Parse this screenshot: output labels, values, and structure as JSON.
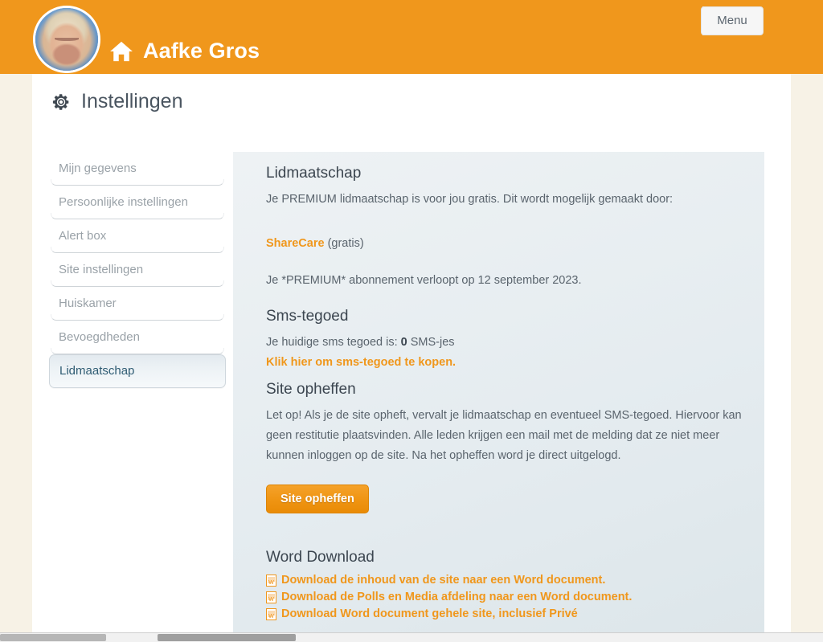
{
  "header": {
    "site_name": "Aafke Gros",
    "home_icon": "home-icon",
    "avatar_alt": "avatar",
    "mini_avatar_alt": "account-avatar",
    "menu_label": "Menu",
    "bar_color": "#f0971c"
  },
  "page": {
    "title": "Instellingen",
    "gear_icon": "gear-icon"
  },
  "sidebar": {
    "items": [
      {
        "label": "Mijn gegevens",
        "active": false
      },
      {
        "label": "Persoonlijke instellingen",
        "active": false
      },
      {
        "label": "Alert box",
        "active": false
      },
      {
        "label": "Site instellingen",
        "active": false
      },
      {
        "label": "Huiskamer",
        "active": false
      },
      {
        "label": "Bevoegdheden",
        "active": false
      },
      {
        "label": "Lidmaatschap",
        "active": true
      }
    ]
  },
  "main": {
    "membership": {
      "heading": "Lidmaatschap",
      "intro": "Je PREMIUM lidmaatschap is voor jou gratis. Dit wordt mogelijk gemaakt door:",
      "sponsor_link": "ShareCare",
      "sponsor_suffix": " (gratis)",
      "expiry": "Je *PREMIUM* abonnement verloopt op 12 september 2023."
    },
    "sms": {
      "heading": "Sms-tegoed",
      "balance_prefix": "Je huidige sms tegoed is: ",
      "balance_value": "0",
      "balance_suffix": " SMS-jes",
      "buy_link": "Klik hier om sms-tegoed te kopen."
    },
    "cancel": {
      "heading": "Site opheffen",
      "warning": "Let op! Als je de site opheft, vervalt je lidmaatschap en eventueel SMS-tegoed. Hiervoor kan geen restitutie plaatsvinden. Alle leden krijgen een mail met de melding dat ze niet meer kunnen inloggen op de site. Na het opheffen word je direct uitgelogd.",
      "button_label": "Site opheffen",
      "button_color": "#ef9412"
    },
    "word_download": {
      "heading": "Word Download",
      "icon": "word-document-icon",
      "links": [
        "Download de inhoud van de site naar een Word document.",
        "Download de Polls en Media afdeling naar een Word document.",
        "Download Word document gehele site, inclusief Privé"
      ]
    }
  },
  "colors": {
    "accent_orange": "#f0971c",
    "panel_bg": "#e5ecf0",
    "page_bg": "#f7f2e6",
    "text_muted": "#9aa2a8",
    "text_body": "#5a646d"
  }
}
